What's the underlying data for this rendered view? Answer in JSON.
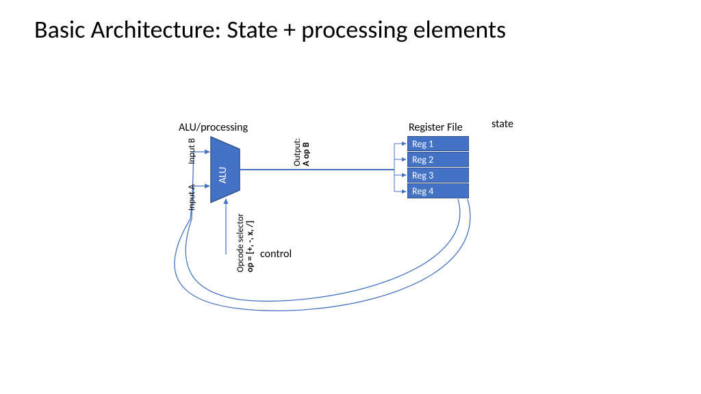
{
  "title": "Basic Architecture: State + processing elements",
  "labels": {
    "alu_section": "ALU/processing",
    "register_section": "Register File",
    "state": "state",
    "alu_block": "ALU",
    "input_a": "Input A",
    "input_b": "Input B",
    "output_line1": "Output:",
    "output_line2": "A op B",
    "opcode_line1": "Opcode selector",
    "opcode_line2": "op = [+, -, x, /]",
    "control": "control"
  },
  "registers": [
    "Reg 1",
    "Reg 2",
    "Reg 3",
    "Reg 4"
  ],
  "colors": {
    "shape_fill": "#4472C4",
    "shape_stroke": "#2F528F",
    "line": "#4472C4"
  }
}
